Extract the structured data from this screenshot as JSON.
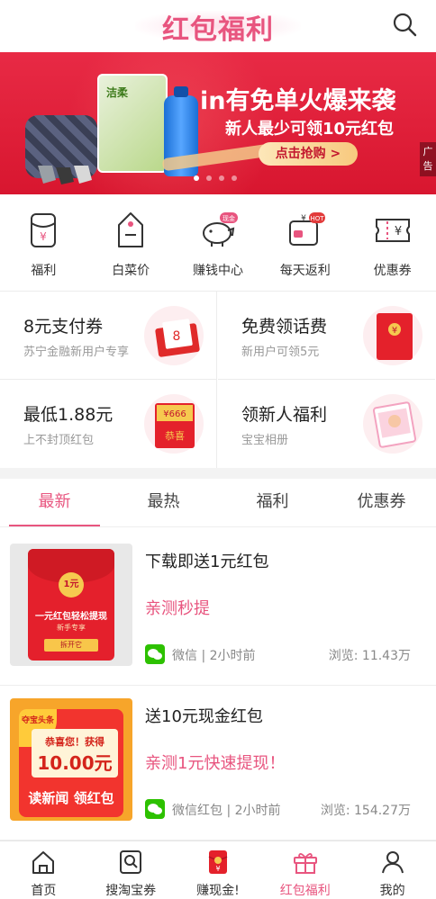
{
  "header": {
    "title": "红包福利"
  },
  "banner": {
    "headline": "in有免单火爆来袭",
    "subline": "新人最少可领10元红包",
    "cta": "点击抢购 >",
    "ad_label": "广告",
    "product_label": "洁柔",
    "slides": 4,
    "active_slide": 0
  },
  "icon_nav": [
    {
      "label": "福利",
      "icon": "red-envelope-icon"
    },
    {
      "label": "白菜价",
      "icon": "price-tag-icon"
    },
    {
      "label": "赚钱中心",
      "icon": "piggy-bank-icon",
      "badge": "现金"
    },
    {
      "label": "每天返利",
      "icon": "wallet-icon",
      "badge": "HOT"
    },
    {
      "label": "优惠券",
      "icon": "coupon-icon"
    }
  ],
  "promos": [
    {
      "title": "8元支付券",
      "subtitle": "苏宁金融新用户专享",
      "art_text": "8"
    },
    {
      "title": "免费领话费",
      "subtitle": "新用户可领5元",
      "art_text": "¥"
    },
    {
      "title": "最低1.88元",
      "subtitle": "上不封顶红包",
      "art_text_top": "¥666",
      "art_text_bottom": "恭喜"
    },
    {
      "title": "领新人福利",
      "subtitle": "宝宝相册",
      "art_text": ""
    }
  ],
  "tabs": [
    "最新",
    "最热",
    "福利",
    "优惠券"
  ],
  "active_tab": 0,
  "feed": [
    {
      "title": "下载即送1元红包",
      "tag": "亲测秒提",
      "source": "微信 | 2小时前",
      "views": "浏览: 11.43万",
      "thumb": {
        "coin": "1元",
        "line1": "一元红包轻松提现",
        "line2": "新手专享",
        "button": "拆开它"
      }
    },
    {
      "title": "送10元现金红包",
      "tag": "亲测1元快速提现！",
      "source": "微信红包 | 2小时前",
      "views": "浏览: 154.27万",
      "thumb": {
        "badge": "夺宝头条",
        "line1": "恭喜您！获得",
        "amount": "10.00元",
        "line2": "读新闻 领红包"
      }
    }
  ],
  "bottom_nav": [
    {
      "label": "首页",
      "icon": "home-icon"
    },
    {
      "label": "搜淘宝券",
      "icon": "search-coupon-icon"
    },
    {
      "label": "赚现金!",
      "icon": "red-packet-icon"
    },
    {
      "label": "红包福利",
      "icon": "gift-icon"
    },
    {
      "label": "我的",
      "icon": "user-icon"
    }
  ],
  "active_bottom": 3,
  "colors": {
    "accent": "#e8557f",
    "banner_red": "#e01f3a"
  }
}
